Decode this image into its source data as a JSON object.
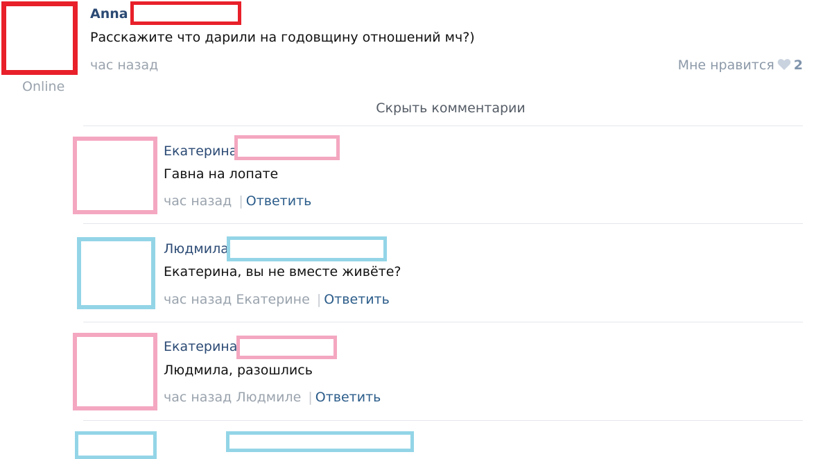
{
  "post": {
    "author": "Anna",
    "text": "Расскажите что дарили на годовщину отношений мч?)",
    "time": "час назад",
    "status": "Online",
    "like_label": "Мне нравится",
    "like_count": "2",
    "hide_comments": "Скрыть комментарии"
  },
  "comments": [
    {
      "author": "Екатерина",
      "text": "Гавна на лопате",
      "time": "час назад",
      "reply_to": "",
      "separator": "|",
      "reply_label": "Ответить"
    },
    {
      "author": "Людмила",
      "text": "Екатерина, вы не вместе живёте?",
      "time": "час назад",
      "reply_to": "Екатерине",
      "separator": "|",
      "reply_label": "Ответить"
    },
    {
      "author": "Екатерина",
      "text": "Людмила, разошлись",
      "time": "час назад",
      "reply_to": "Людмиле",
      "separator": "|",
      "reply_label": "Ответить"
    }
  ],
  "colors": {
    "red": "#e8202a",
    "pink": "#f4a7c0",
    "blue": "#93d5e7",
    "link": "#2b4a74"
  }
}
